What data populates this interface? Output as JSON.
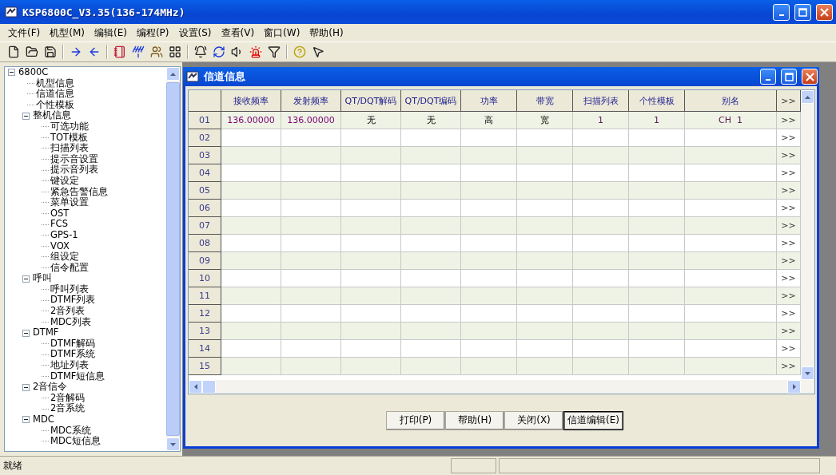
{
  "window": {
    "title": "KSP6800C_V3.35(136-174MHz)"
  },
  "menu": [
    "文件(F)",
    "机型(M)",
    "编辑(E)",
    "编程(P)",
    "设置(S)",
    "查看(V)",
    "窗口(W)",
    "帮助(H)"
  ],
  "tree": {
    "label": "6800C",
    "expanded": true,
    "children": [
      {
        "label": "机型信息"
      },
      {
        "label": "信道信息"
      },
      {
        "label": "个性模板"
      },
      {
        "label": "整机信息",
        "expanded": true,
        "children": [
          {
            "label": "可选功能"
          },
          {
            "label": "TOT模板"
          },
          {
            "label": "扫描列表"
          },
          {
            "label": "提示音设置"
          },
          {
            "label": "提示音列表"
          },
          {
            "label": "键设定"
          },
          {
            "label": "紧急告警信息"
          },
          {
            "label": "菜单设置"
          },
          {
            "label": "OST"
          },
          {
            "label": "FCS"
          },
          {
            "label": "GPS-1"
          },
          {
            "label": "VOX"
          },
          {
            "label": "组设定"
          },
          {
            "label": "信令配置"
          }
        ]
      },
      {
        "label": "呼叫",
        "expanded": true,
        "children": [
          {
            "label": "呼叫列表"
          },
          {
            "label": "DTMF列表"
          },
          {
            "label": "2音列表"
          },
          {
            "label": "MDC列表"
          }
        ]
      },
      {
        "label": "DTMF",
        "expanded": true,
        "children": [
          {
            "label": "DTMF解码"
          },
          {
            "label": "DTMF系统"
          },
          {
            "label": "地址列表"
          },
          {
            "label": "DTMF短信息"
          }
        ]
      },
      {
        "label": "2音信令",
        "expanded": true,
        "children": [
          {
            "label": "2音解码"
          },
          {
            "label": "2音系统"
          }
        ]
      },
      {
        "label": "MDC",
        "expanded": true,
        "children": [
          {
            "label": "MDC系统"
          },
          {
            "label": "MDC短信息"
          }
        ]
      }
    ]
  },
  "channel_window": {
    "title": "信道信息",
    "columns": [
      "接收频率",
      "发射频率",
      "QT/DQT解码",
      "QT/DQT编码",
      "功率",
      "带宽",
      "扫描列表",
      "个性模板",
      "别名",
      ">>"
    ],
    "rows": [
      {
        "number": "01",
        "cells": [
          "136.00000",
          "136.00000",
          "无",
          "无",
          "高",
          "宽",
          "1",
          "1",
          "CH  1"
        ],
        "more": ">>"
      },
      {
        "number": "02",
        "more": ">>"
      },
      {
        "number": "03",
        "more": ">>"
      },
      {
        "number": "04",
        "more": ">>"
      },
      {
        "number": "05",
        "more": ">>"
      },
      {
        "number": "06",
        "more": ">>"
      },
      {
        "number": "07",
        "more": ">>"
      },
      {
        "number": "08",
        "more": ">>"
      },
      {
        "number": "09",
        "more": ">>"
      },
      {
        "number": "10",
        "more": ">>"
      },
      {
        "number": "11",
        "more": ">>"
      },
      {
        "number": "12",
        "more": ">>"
      },
      {
        "number": "13",
        "more": ">>"
      },
      {
        "number": "14",
        "more": ">>"
      },
      {
        "number": "15",
        "more": ">>"
      }
    ],
    "buttons": [
      {
        "label": "打印(P)",
        "focused": false
      },
      {
        "label": "帮助(H)",
        "focused": false
      },
      {
        "label": "关闭(X)",
        "focused": false
      },
      {
        "label": "信道编辑(E)",
        "focused": true
      }
    ]
  },
  "status_bar": {
    "text": "就绪"
  }
}
